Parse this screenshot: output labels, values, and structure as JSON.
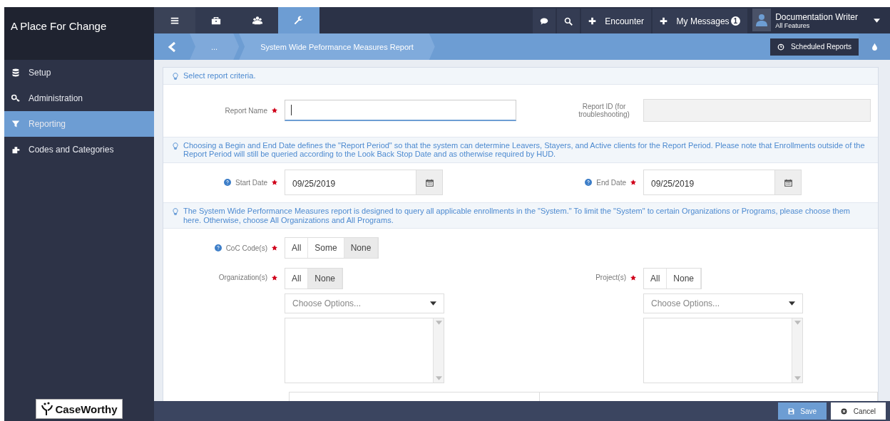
{
  "brand": "A Place For Change",
  "sidebar": {
    "items": [
      {
        "label": "Setup",
        "selected": false
      },
      {
        "label": "Administration",
        "selected": false
      },
      {
        "label": "Reporting",
        "selected": true
      },
      {
        "label": "Codes and Categories",
        "selected": false
      }
    ]
  },
  "logo": "CaseWorthy",
  "top_nav": {
    "tabs": [
      {
        "selected": false
      },
      {
        "selected": false
      },
      {
        "selected": false
      },
      {
        "selected": true
      }
    ]
  },
  "header": {
    "encounter": "Encounter",
    "messages": "My Messages",
    "message_count": "1",
    "user_name": "Documentation Writer",
    "user_role": "All Features"
  },
  "breadcrumb": {
    "ellipsis": "...",
    "title": "System Wide Peformance Measures Report",
    "scheduled_reports": "Scheduled Reports"
  },
  "form": {
    "intro": "Select report criteria.",
    "report_name": {
      "label": "Report Name"
    },
    "report_id": {
      "label": "Report ID (for troubleshooting)"
    },
    "date_note": "Choosing a Begin and End Date defines the \"Report Period\" so that the system can determine Leavers, Stayers, and Active clients for the Report Period. Please note that Enrollments outside of the Report Period will still be queried according to the Look Back Stop Date and as otherwise required by HUD.",
    "start_date": {
      "label": "Start Date",
      "value": "09/25/2019"
    },
    "end_date": {
      "label": "End Date",
      "value": "09/25/2019"
    },
    "scope_note": "The System Wide Performance Measures report is designed to query all applicable enrollments in the \"System.\" To limit the \"System\" to certain Organizations or Programs, please choose them here. Otherwise, choose All Organizations and All Programs.",
    "coc": {
      "label": "CoC Code(s)",
      "options": [
        {
          "label": "All",
          "selected": false
        },
        {
          "label": "Some",
          "selected": false
        },
        {
          "label": "None",
          "selected": true
        }
      ]
    },
    "organizations": {
      "label": "Organization(s)",
      "options": [
        {
          "label": "All",
          "selected": false
        },
        {
          "label": "None",
          "selected": true
        }
      ],
      "placeholder": "Choose Options..."
    },
    "projects": {
      "label": "Project(s)",
      "options": [
        {
          "label": "All",
          "selected": false
        },
        {
          "label": "None",
          "selected": false
        }
      ],
      "placeholder": "Choose Options..."
    }
  },
  "footer": {
    "save": "Save",
    "cancel": "Cancel"
  }
}
